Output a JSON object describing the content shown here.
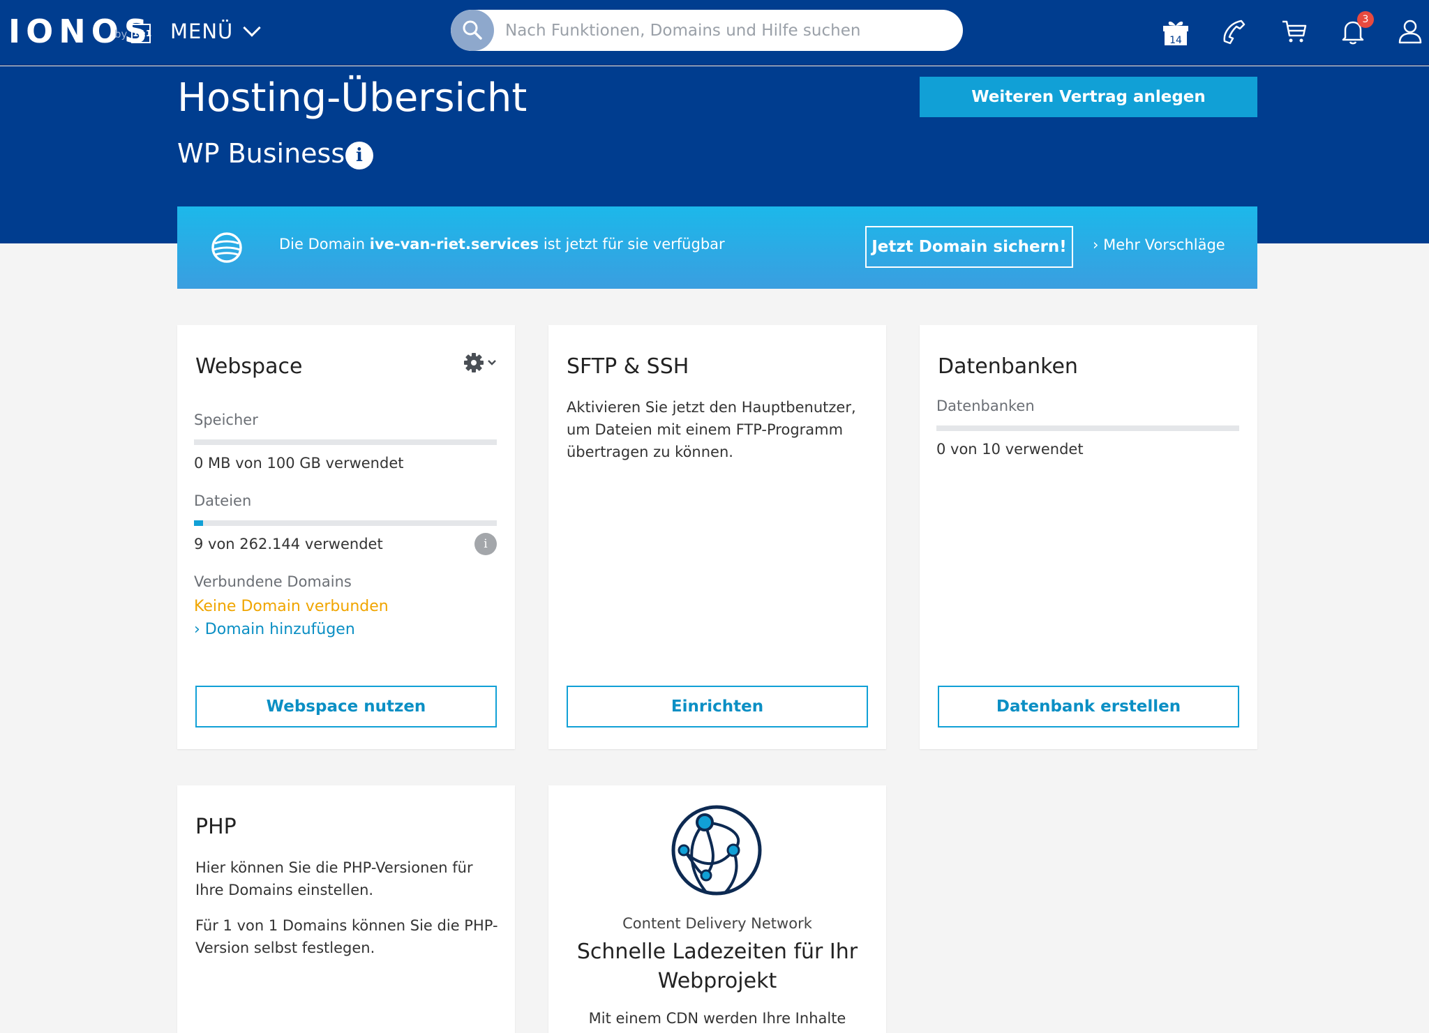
{
  "nav": {
    "logo": "IONOS",
    "logo_by": "by",
    "logo_brand": "1&1",
    "menu_label": "MENÜ",
    "search_placeholder": "Nach Funktionen, Domains und Hilfe suchen",
    "gift_count": "14",
    "notification_count": "3",
    "icons": [
      "gift-icon",
      "phone-icon",
      "cart-icon",
      "bell-icon",
      "user-icon"
    ]
  },
  "header": {
    "title": "Hosting-Übersicht",
    "subtitle": "WP Business",
    "info": "i",
    "new_contract_button": "Weiteren Vertrag anlegen"
  },
  "promo": {
    "text_prefix": "Die Domain ",
    "domain": "ive-van-riet.services",
    "text_suffix": " ist jetzt für sie verfügbar",
    "cta": "Jetzt Domain sichern!",
    "more": "Mehr Vorschläge"
  },
  "webspace": {
    "title": "Webspace",
    "storage_label": "Speicher",
    "storage_value": "0 MB von 100 GB verwendet",
    "storage_fraction": 0,
    "files_label": "Dateien",
    "files_value": "9 von 262.144 verwendet",
    "files_fraction": 0.03,
    "files_info": "i",
    "domains_label": "Verbundene Domains",
    "domains_warning": "Keine Domain verbunden",
    "add_domain_link": "Domain hinzufügen",
    "button": "Webspace nutzen"
  },
  "sftp": {
    "title": "SFTP & SSH",
    "description": "Aktivieren Sie jetzt den Hauptbenutzer, um Dateien mit einem FTP-Programm übertragen zu können.",
    "button": "Einrichten"
  },
  "databases": {
    "title": "Datenbanken",
    "label": "Datenbanken",
    "value": "0 von 10 verwendet",
    "fraction": 0,
    "button": "Datenbank erstellen"
  },
  "php": {
    "title": "PHP",
    "text1": "Hier können Sie die PHP-Versionen für Ihre Domains einstellen.",
    "text2": "Für 1 von 1 Domains können Sie die PHP-Version selbst festlegen."
  },
  "cdn": {
    "label": "Content Delivery Network",
    "headline": "Schnelle Ladezeiten für Ihr Webprojekt",
    "text": "Mit einem CDN werden Ihre Inhalte"
  },
  "colors": {
    "nav_bg": "#003d8f",
    "accent": "#11a0d6",
    "warning": "#f0a500",
    "badge": "#e84a3f"
  }
}
